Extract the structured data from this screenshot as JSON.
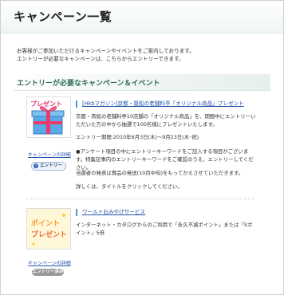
{
  "page": {
    "title": "キャンペーン一覧"
  },
  "intro": {
    "line1": "お客様がご参加いただけるキャンペーンやイベントをご案内しております。",
    "line2": "エントリーが必要なキャンペーンは、こちらからエントリーできます。"
  },
  "section": {
    "title": "エントリーが必要なキャンペーン＆イベント"
  },
  "campaigns": [
    {
      "thumb_label": "プレゼント",
      "title": "[Hkbマガジン]京都・貴船の老舗料亭「オリジナル商品」プレゼント",
      "desc1": "京都・貴船の老舗料亭10店舗の「オリジナル商品」を、期間中にエントリーいただいた方の中から抽選で100名様にプレゼントいたします。",
      "period": "エントリー期間:2010年6月3日(木)～9月23日(木･祝)",
      "note1": "●アンケート項目の中にエントリーキーワードをご記入する項目がございます。特集記事内のエントリーキーワードをご確認のうえ、エントリーしてください。",
      "note2": "当選者の発表は賞品の発送(10月中旬)をもってかえさせていただきます。",
      "note3": "詳しくは、タイトルをクリックしてください。",
      "detail_link": "キャンペーンの詳細",
      "entry_button": "エントリー"
    },
    {
      "thumb_label1": "ポイント",
      "thumb_label2": "プレゼント",
      "title": "ワールドおみやげサービス",
      "desc1": "インターネット・カタログからのご利用で「永久不滅ポイント」または「Sポイント」5倍",
      "detail_link": "キャンペーンの詳細",
      "entry_status": "エントリー済み"
    }
  ],
  "colors": {
    "link": "#2255aa",
    "section_title": "#2b6b50",
    "badge_done": "#9a9a9a"
  }
}
